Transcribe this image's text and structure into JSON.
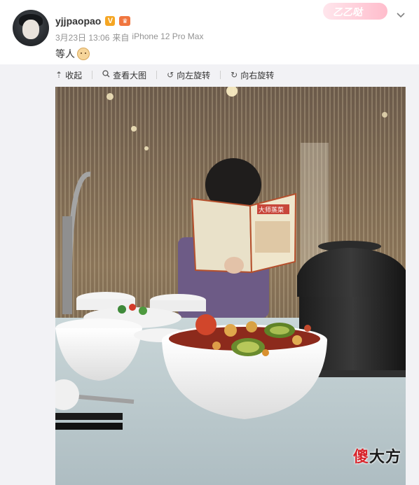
{
  "post": {
    "username": "yjjpaopao",
    "verified_badge": "V",
    "vip_badge": "♛",
    "timestamp": "3月23日 13:06",
    "source_prefix": "来自",
    "source_device": "iPhone 12 Pro Max",
    "text": "等人",
    "emoji": "doge-emoji",
    "card_background_text": "乙乙哒"
  },
  "toolbar": {
    "collapse": "收起",
    "view_large": "查看大图",
    "rotate_left": "向左旋转",
    "rotate_right": "向右旋转"
  },
  "photo": {
    "watermark_accent": "傻",
    "watermark_rest": "大方",
    "book_title": "大师蒸菜"
  },
  "colors": {
    "meta_gray": "#939393",
    "v_badge": "#f5a623",
    "vip_badge": "#f0763f",
    "watermark_red": "#d8242b"
  }
}
